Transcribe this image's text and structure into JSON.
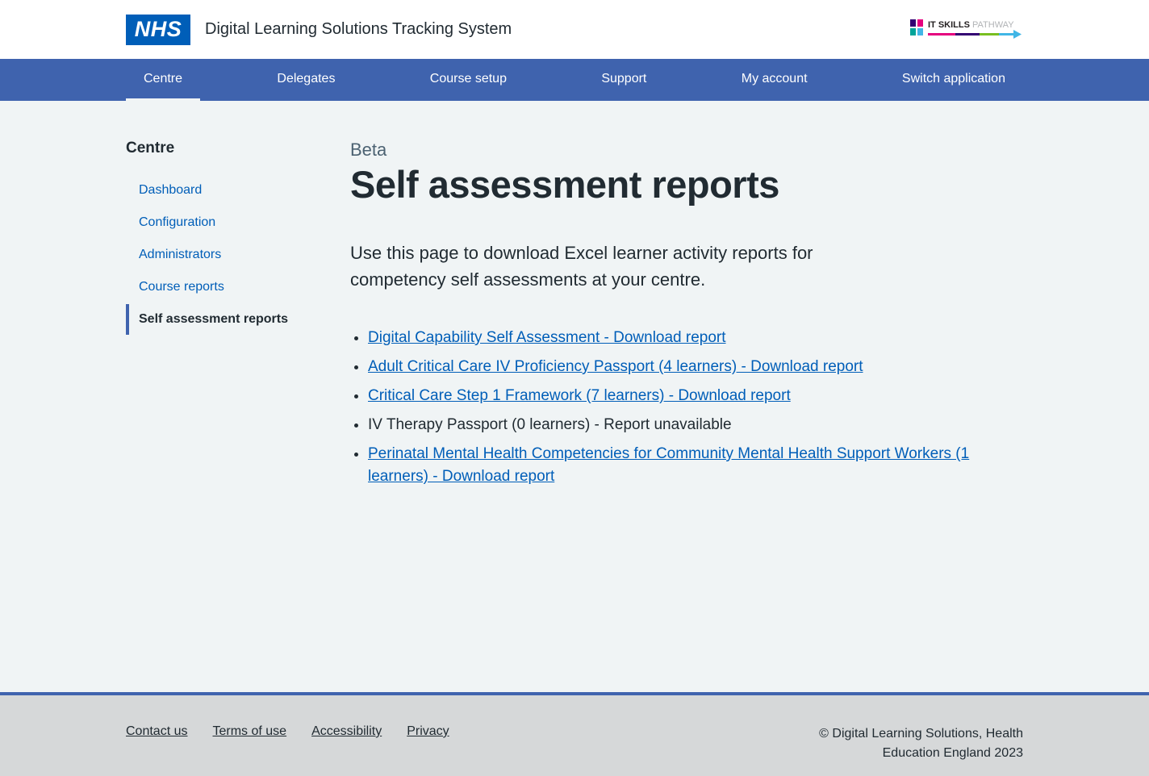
{
  "header": {
    "logo_text": "NHS",
    "app_title": "Digital Learning Solutions Tracking System",
    "partner_logo": {
      "bold": "IT SKILLS",
      "light": "PATHWAY"
    }
  },
  "nav": {
    "items": [
      {
        "label": "Centre",
        "active": true
      },
      {
        "label": "Delegates",
        "active": false
      },
      {
        "label": "Course setup",
        "active": false
      },
      {
        "label": "Support",
        "active": false
      },
      {
        "label": "My account",
        "active": false
      },
      {
        "label": "Switch application",
        "active": false
      }
    ]
  },
  "sidebar": {
    "title": "Centre",
    "items": [
      {
        "label": "Dashboard",
        "active": false
      },
      {
        "label": "Configuration",
        "active": false
      },
      {
        "label": "Administrators",
        "active": false
      },
      {
        "label": "Course reports",
        "active": false
      },
      {
        "label": "Self assessment reports",
        "active": true
      }
    ]
  },
  "main": {
    "beta_label": "Beta",
    "title": "Self assessment reports",
    "description": "Use this page to download Excel learner activity reports for competency self assessments at your centre.",
    "reports": [
      {
        "label": "Digital Capability Self Assessment - Download report",
        "link": true
      },
      {
        "label": "Adult Critical Care IV Proficiency Passport (4 learners) - Download report",
        "link": true
      },
      {
        "label": "Critical Care Step 1 Framework (7 learners) - Download report",
        "link": true
      },
      {
        "label": "IV Therapy Passport (0 learners) - Report unavailable",
        "link": false
      },
      {
        "label": "Perinatal Mental Health Competencies for Community Mental Health Support Workers (1 learners) - Download report",
        "link": true
      }
    ]
  },
  "footer": {
    "links": [
      "Contact us",
      "Terms of use",
      "Accessibility",
      "Privacy"
    ],
    "copyright_line1": "© Digital Learning Solutions, Health",
    "copyright_line2": "Education England 2023"
  },
  "colors": {
    "nhs_blue": "#005eb8",
    "nav_blue": "#3f63ae",
    "link_blue": "#005eb8",
    "text_dark": "#212b32",
    "page_bg": "#f0f4f5",
    "footer_bg": "#d6d8d9"
  }
}
